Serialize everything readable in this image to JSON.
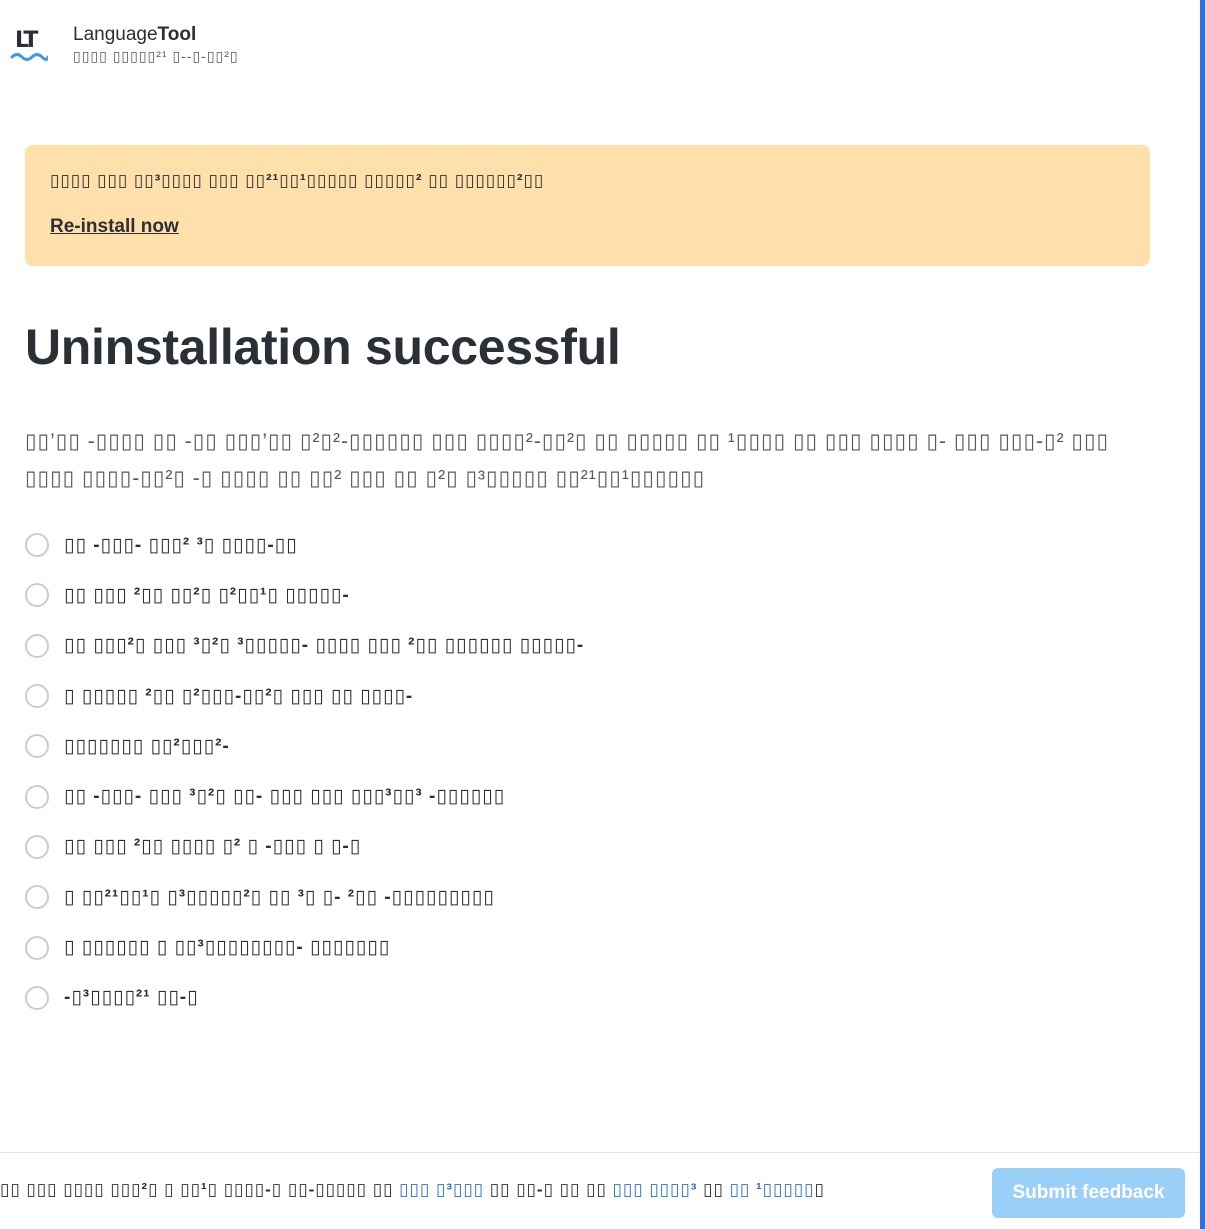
{
  "header": {
    "logo_text": "LT",
    "brand_regular": "Language",
    "brand_bold": "Tool",
    "subtitle": "▯▯▯▯ ▯▯▯▯▯²¹ ▯--▯-▯▯²▯"
  },
  "banner": {
    "message": "▯▯▯▯ ▯▯▯ ▯▯³▯▯▯▯ ▯▯▯ ▯▯²¹▯▯¹▯▯▯▯▯ ▯▯▯▯▯² ▯▯ ▯▯▯▯▯▯²▯▯",
    "action_label": "Re-install now"
  },
  "page": {
    "title": "Uninstallation successful",
    "description": "▯▯’▯▯ -▯▯▯▯ ▯▯ -▯▯ ▯▯▯’▯▯ ▯²▯²-▯▯▯▯▯▯ ▯▯▯ ▯▯▯▯²-▯▯²▯ ▯▯ ▯▯▯▯▯ ▯▯ ¹▯▯▯▯ ▯▯ ▯▯▯ ▯▯▯▯ ▯- ▯▯▯ ▯▯▯-▯² ▯▯▯ ▯▯▯▯ ▯▯▯▯-▯▯²▯ -▯ ▯▯▯▯ ▯▯ ▯▯² ▯▯▯ ▯▯ ▯²▯ ▯³▯▯▯▯▯ ▯▯²¹▯▯¹▯▯▯▯▯▯"
  },
  "options": [
    {
      "label": "▯▯ -▯▯▯- ▯▯▯² ³▯ ▯▯▯▯-▯▯"
    },
    {
      "label": "▯▯ ▯▯▯ ²▯▯ ▯▯²▯ ▯²▯▯¹▯ ▯▯▯▯▯-"
    },
    {
      "label": "▯▯ ▯▯▯²▯ ▯▯▯ ³▯²▯ ³▯▯▯▯▯- ▯▯▯▯ ▯▯▯ ²▯▯ ▯▯▯▯▯▯ ▯▯▯▯▯-"
    },
    {
      "label": "▯ ▯▯▯▯▯ ²▯▯ ▯²▯▯▯-▯▯²▯ ▯▯▯ ▯▯ ▯▯▯▯-"
    },
    {
      "label": "▯▯▯▯▯▯▯ ▯▯²▯▯▯²-"
    },
    {
      "label": "▯▯ -▯▯▯- ▯▯▯ ³▯²▯ ▯▯- ▯▯▯ ▯▯▯ ▯▯▯³▯▯³ -▯▯▯▯▯▯"
    },
    {
      "label": "▯▯ ▯▯▯ ²▯▯ ▯▯▯▯ ▯² ▯ -▯▯▯ ▯ ▯-▯"
    },
    {
      "label": "▯ ▯▯²¹▯▯¹▯ ▯³▯▯▯▯▯²▯ ▯▯ ³▯ ▯- ²▯▯ -▯▯▯▯▯▯▯▯▯"
    },
    {
      "label": "▯ ▯▯▯▯▯▯ ▯ ▯▯³▯▯▯▯▯▯▯▯- ▯▯▯▯▯▯▯"
    },
    {
      "label": "-▯³▯▯▯▯²¹ ▯▯-▯"
    }
  ],
  "footer": {
    "text_part1": "▯▯ ▯▯▯ ▯▯▯▯ ▯▯▯²▯ ▯ ▯▯¹▯ ▯▯▯▯-▯ ▯▯-▯▯▯▯▯ ▯▯ ",
    "link1": "▯▯▯ ▯³▯▯▯",
    "text_part2": " ▯▯ ▯▯-▯ ▯▯ ▯▯ ",
    "link2": "▯▯▯ ▯▯▯▯³",
    "text_part3": " ▯▯ ",
    "link3": "▯▯ ¹▯▯▯▯▯",
    "text_part4": "▯",
    "submit_label": "Submit feedback"
  },
  "colors": {
    "banner_bg": "#ffdfaa",
    "accent": "#2f6fd6",
    "submit_disabled": "#9ccff7",
    "text": "#2b2f36"
  }
}
